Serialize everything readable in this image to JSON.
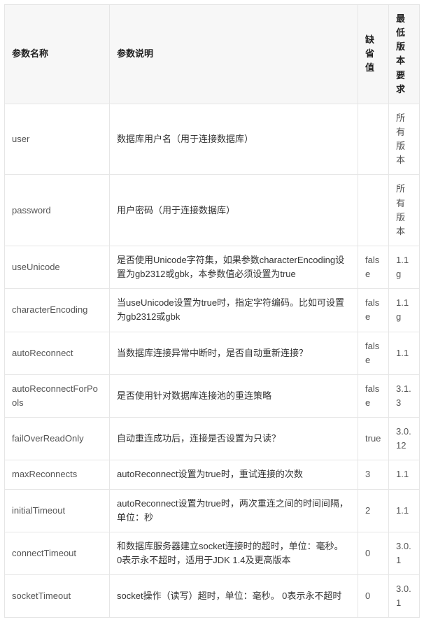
{
  "headers": {
    "name": "参数名称",
    "desc": "参数说明",
    "defaultValue": "缺省值",
    "minVersion": "最低版本要求"
  },
  "rows": [
    {
      "name": "user",
      "desc": "数据库用户名（用于连接数据库）",
      "defaultValue": "",
      "minVersion": "所有版本"
    },
    {
      "name": "password",
      "desc": "用户密码（用于连接数据库）",
      "defaultValue": "",
      "minVersion": "所有版本"
    },
    {
      "name": "useUnicode",
      "desc": "是否使用Unicode字符集，如果参数characterEncoding设置为gb2312或gbk，本参数值必须设置为true",
      "defaultValue": "false",
      "minVersion": "1.1g"
    },
    {
      "name": "characterEncoding",
      "desc": "当useUnicode设置为true时，指定字符编码。比如可设置为gb2312或gbk",
      "defaultValue": "false",
      "minVersion": "1.1g"
    },
    {
      "name": "autoReconnect",
      "desc": "当数据库连接异常中断时，是否自动重新连接？",
      "defaultValue": "false",
      "minVersion": "1.1"
    },
    {
      "name": "autoReconnectForPools",
      "desc": "是否使用针对数据库连接池的重连策略",
      "defaultValue": "false",
      "minVersion": "3.1.3"
    },
    {
      "name": "failOverReadOnly",
      "desc": "自动重连成功后，连接是否设置为只读？",
      "defaultValue": "true",
      "minVersion": "3.0.12"
    },
    {
      "name": "maxReconnects",
      "desc": "autoReconnect设置为true时，重试连接的次数",
      "defaultValue": "3",
      "minVersion": "1.1"
    },
    {
      "name": "initialTimeout",
      "desc": "autoReconnect设置为true时，两次重连之间的时间间隔，单位：秒",
      "defaultValue": "2",
      "minVersion": "1.1"
    },
    {
      "name": "connectTimeout",
      "desc": "和数据库服务器建立socket连接时的超时，单位：毫秒。 0表示永不超时，适用于JDK 1.4及更高版本",
      "defaultValue": "0",
      "minVersion": "3.0.1"
    },
    {
      "name": "socketTimeout",
      "desc": "socket操作（读写）超时，单位：毫秒。 0表示永不超时",
      "defaultValue": "0",
      "minVersion": "3.0.1"
    }
  ]
}
